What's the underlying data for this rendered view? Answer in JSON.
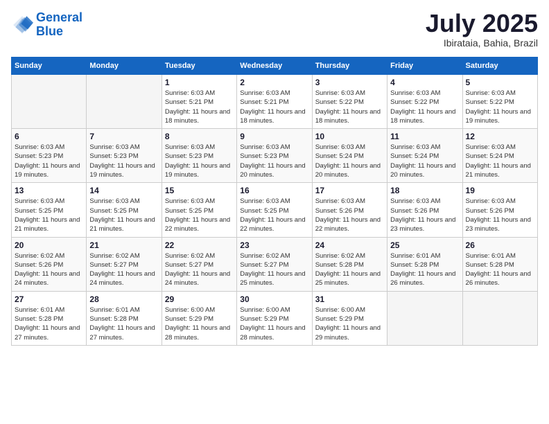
{
  "header": {
    "logo_line1": "General",
    "logo_line2": "Blue",
    "month": "July 2025",
    "location": "Ibirataia, Bahia, Brazil"
  },
  "weekdays": [
    "Sunday",
    "Monday",
    "Tuesday",
    "Wednesday",
    "Thursday",
    "Friday",
    "Saturday"
  ],
  "weeks": [
    [
      {
        "day": "",
        "info": ""
      },
      {
        "day": "",
        "info": ""
      },
      {
        "day": "1",
        "info": "Sunrise: 6:03 AM\nSunset: 5:21 PM\nDaylight: 11 hours and 18 minutes."
      },
      {
        "day": "2",
        "info": "Sunrise: 6:03 AM\nSunset: 5:21 PM\nDaylight: 11 hours and 18 minutes."
      },
      {
        "day": "3",
        "info": "Sunrise: 6:03 AM\nSunset: 5:22 PM\nDaylight: 11 hours and 18 minutes."
      },
      {
        "day": "4",
        "info": "Sunrise: 6:03 AM\nSunset: 5:22 PM\nDaylight: 11 hours and 18 minutes."
      },
      {
        "day": "5",
        "info": "Sunrise: 6:03 AM\nSunset: 5:22 PM\nDaylight: 11 hours and 19 minutes."
      }
    ],
    [
      {
        "day": "6",
        "info": "Sunrise: 6:03 AM\nSunset: 5:23 PM\nDaylight: 11 hours and 19 minutes."
      },
      {
        "day": "7",
        "info": "Sunrise: 6:03 AM\nSunset: 5:23 PM\nDaylight: 11 hours and 19 minutes."
      },
      {
        "day": "8",
        "info": "Sunrise: 6:03 AM\nSunset: 5:23 PM\nDaylight: 11 hours and 19 minutes."
      },
      {
        "day": "9",
        "info": "Sunrise: 6:03 AM\nSunset: 5:23 PM\nDaylight: 11 hours and 20 minutes."
      },
      {
        "day": "10",
        "info": "Sunrise: 6:03 AM\nSunset: 5:24 PM\nDaylight: 11 hours and 20 minutes."
      },
      {
        "day": "11",
        "info": "Sunrise: 6:03 AM\nSunset: 5:24 PM\nDaylight: 11 hours and 20 minutes."
      },
      {
        "day": "12",
        "info": "Sunrise: 6:03 AM\nSunset: 5:24 PM\nDaylight: 11 hours and 21 minutes."
      }
    ],
    [
      {
        "day": "13",
        "info": "Sunrise: 6:03 AM\nSunset: 5:25 PM\nDaylight: 11 hours and 21 minutes."
      },
      {
        "day": "14",
        "info": "Sunrise: 6:03 AM\nSunset: 5:25 PM\nDaylight: 11 hours and 21 minutes."
      },
      {
        "day": "15",
        "info": "Sunrise: 6:03 AM\nSunset: 5:25 PM\nDaylight: 11 hours and 22 minutes."
      },
      {
        "day": "16",
        "info": "Sunrise: 6:03 AM\nSunset: 5:25 PM\nDaylight: 11 hours and 22 minutes."
      },
      {
        "day": "17",
        "info": "Sunrise: 6:03 AM\nSunset: 5:26 PM\nDaylight: 11 hours and 22 minutes."
      },
      {
        "day": "18",
        "info": "Sunrise: 6:03 AM\nSunset: 5:26 PM\nDaylight: 11 hours and 23 minutes."
      },
      {
        "day": "19",
        "info": "Sunrise: 6:03 AM\nSunset: 5:26 PM\nDaylight: 11 hours and 23 minutes."
      }
    ],
    [
      {
        "day": "20",
        "info": "Sunrise: 6:02 AM\nSunset: 5:26 PM\nDaylight: 11 hours and 24 minutes."
      },
      {
        "day": "21",
        "info": "Sunrise: 6:02 AM\nSunset: 5:27 PM\nDaylight: 11 hours and 24 minutes."
      },
      {
        "day": "22",
        "info": "Sunrise: 6:02 AM\nSunset: 5:27 PM\nDaylight: 11 hours and 24 minutes."
      },
      {
        "day": "23",
        "info": "Sunrise: 6:02 AM\nSunset: 5:27 PM\nDaylight: 11 hours and 25 minutes."
      },
      {
        "day": "24",
        "info": "Sunrise: 6:02 AM\nSunset: 5:28 PM\nDaylight: 11 hours and 25 minutes."
      },
      {
        "day": "25",
        "info": "Sunrise: 6:01 AM\nSunset: 5:28 PM\nDaylight: 11 hours and 26 minutes."
      },
      {
        "day": "26",
        "info": "Sunrise: 6:01 AM\nSunset: 5:28 PM\nDaylight: 11 hours and 26 minutes."
      }
    ],
    [
      {
        "day": "27",
        "info": "Sunrise: 6:01 AM\nSunset: 5:28 PM\nDaylight: 11 hours and 27 minutes."
      },
      {
        "day": "28",
        "info": "Sunrise: 6:01 AM\nSunset: 5:28 PM\nDaylight: 11 hours and 27 minutes."
      },
      {
        "day": "29",
        "info": "Sunrise: 6:00 AM\nSunset: 5:29 PM\nDaylight: 11 hours and 28 minutes."
      },
      {
        "day": "30",
        "info": "Sunrise: 6:00 AM\nSunset: 5:29 PM\nDaylight: 11 hours and 28 minutes."
      },
      {
        "day": "31",
        "info": "Sunrise: 6:00 AM\nSunset: 5:29 PM\nDaylight: 11 hours and 29 minutes."
      },
      {
        "day": "",
        "info": ""
      },
      {
        "day": "",
        "info": ""
      }
    ]
  ]
}
